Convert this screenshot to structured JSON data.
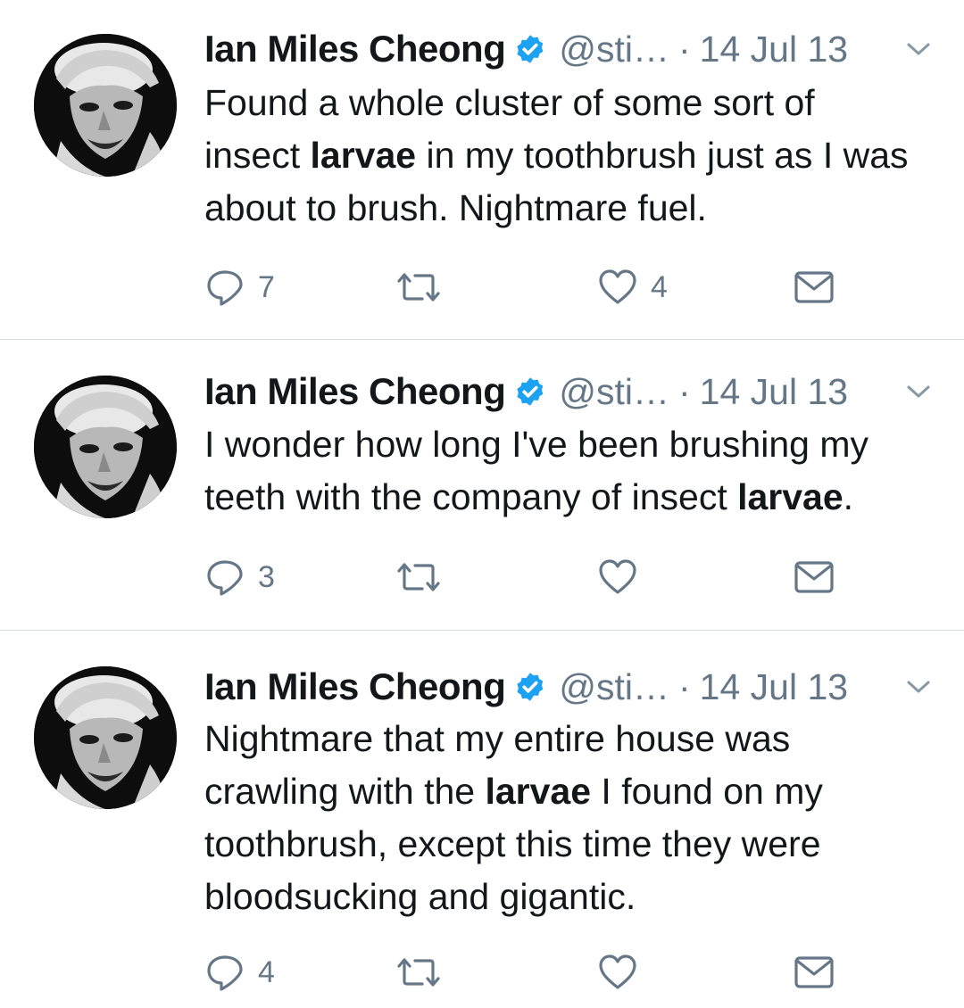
{
  "tweets": [
    {
      "author_name": "Ian Miles Cheong",
      "handle": "@sti…",
      "separator": "·",
      "date": "14 Jul 13",
      "text_parts": [
        "Found a whole cluster of some sort of insect ",
        "larvae",
        " in my toothbrush just as I was about to brush. Nightmare fuel."
      ],
      "reply_count": "7",
      "retweet_count": "",
      "like_count": "4"
    },
    {
      "author_name": "Ian Miles Cheong",
      "handle": "@sti…",
      "separator": "·",
      "date": "14 Jul 13",
      "text_parts": [
        "I wonder how long I've been brushing my teeth with the company of insect ",
        "larvae",
        "."
      ],
      "reply_count": "3",
      "retweet_count": "",
      "like_count": ""
    },
    {
      "author_name": "Ian Miles Cheong",
      "handle": "@sti…",
      "separator": "·",
      "date": "14 Jul 13",
      "text_parts": [
        "Nightmare that my entire house was crawling with the ",
        "larvae",
        " I found on my toothbrush, except this time they were bloodsucking and gigantic."
      ],
      "reply_count": "4",
      "retweet_count": "",
      "like_count": ""
    }
  ],
  "colors": {
    "text": "#14171a",
    "secondary": "#657786",
    "verified": "#1da1f2",
    "divider": "#d8dde1"
  },
  "icons": {
    "reply": "reply-icon",
    "retweet": "retweet-icon",
    "like": "heart-icon",
    "dm": "envelope-icon",
    "verified": "verified-badge-icon",
    "caret": "chevron-down-icon"
  }
}
